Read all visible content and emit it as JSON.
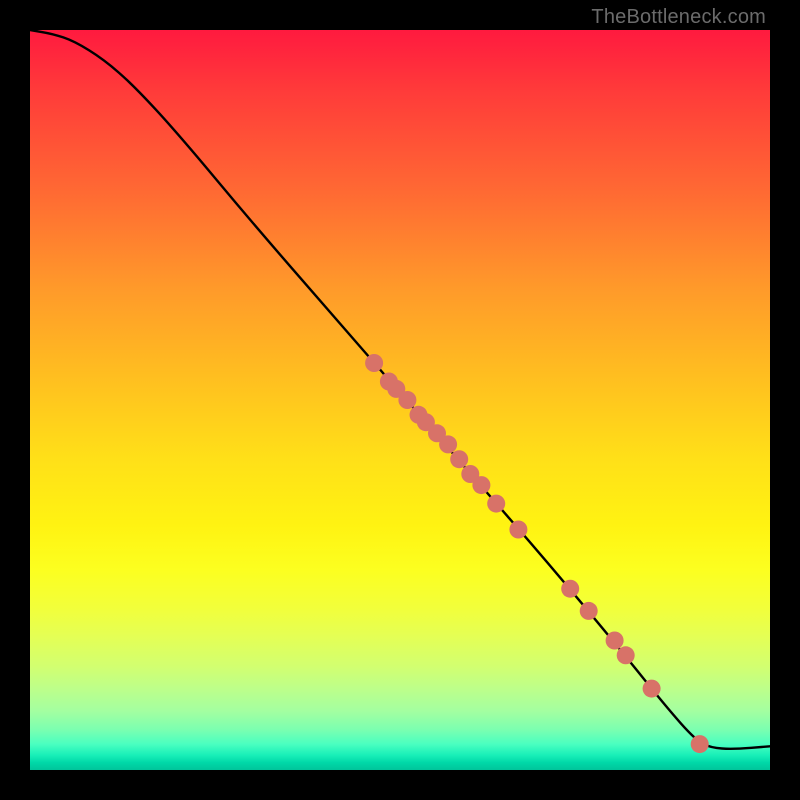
{
  "watermark": "TheBottleneck.com",
  "colors": {
    "frame": "#000000",
    "curve": "#000000",
    "point": "#d87268"
  },
  "chart_data": {
    "type": "line",
    "title": "",
    "xlabel": "",
    "ylabel": "",
    "xlim": [
      0,
      100
    ],
    "ylim": [
      0,
      100
    ],
    "grid": false,
    "legend": false,
    "curve_note": "Values read off the chart; y is percentage height from bottom of plot, x is percentage across plot width.",
    "x": [
      0,
      3,
      6,
      10,
      14,
      20,
      30,
      40,
      50,
      60,
      70,
      80,
      86,
      90,
      92,
      95,
      100
    ],
    "y": [
      100,
      99.5,
      98.5,
      96,
      92.5,
      86,
      74,
      62.5,
      51,
      39.5,
      28,
      16,
      8.5,
      4,
      3,
      2.8,
      3.2
    ],
    "scatter_points": {
      "note": "Highlighted markers along the decline portion of the curve.",
      "x": [
        46.5,
        48.5,
        49.5,
        51,
        52.5,
        53.5,
        55,
        56.5,
        58,
        59.5,
        61,
        63,
        66,
        73,
        75.5,
        79,
        80.5,
        84,
        90.5
      ],
      "y": [
        55,
        52.5,
        51.5,
        50,
        48,
        47,
        45.5,
        44,
        42,
        40,
        38.5,
        36,
        32.5,
        24.5,
        21.5,
        17.5,
        15.5,
        11,
        3.5
      ]
    }
  }
}
